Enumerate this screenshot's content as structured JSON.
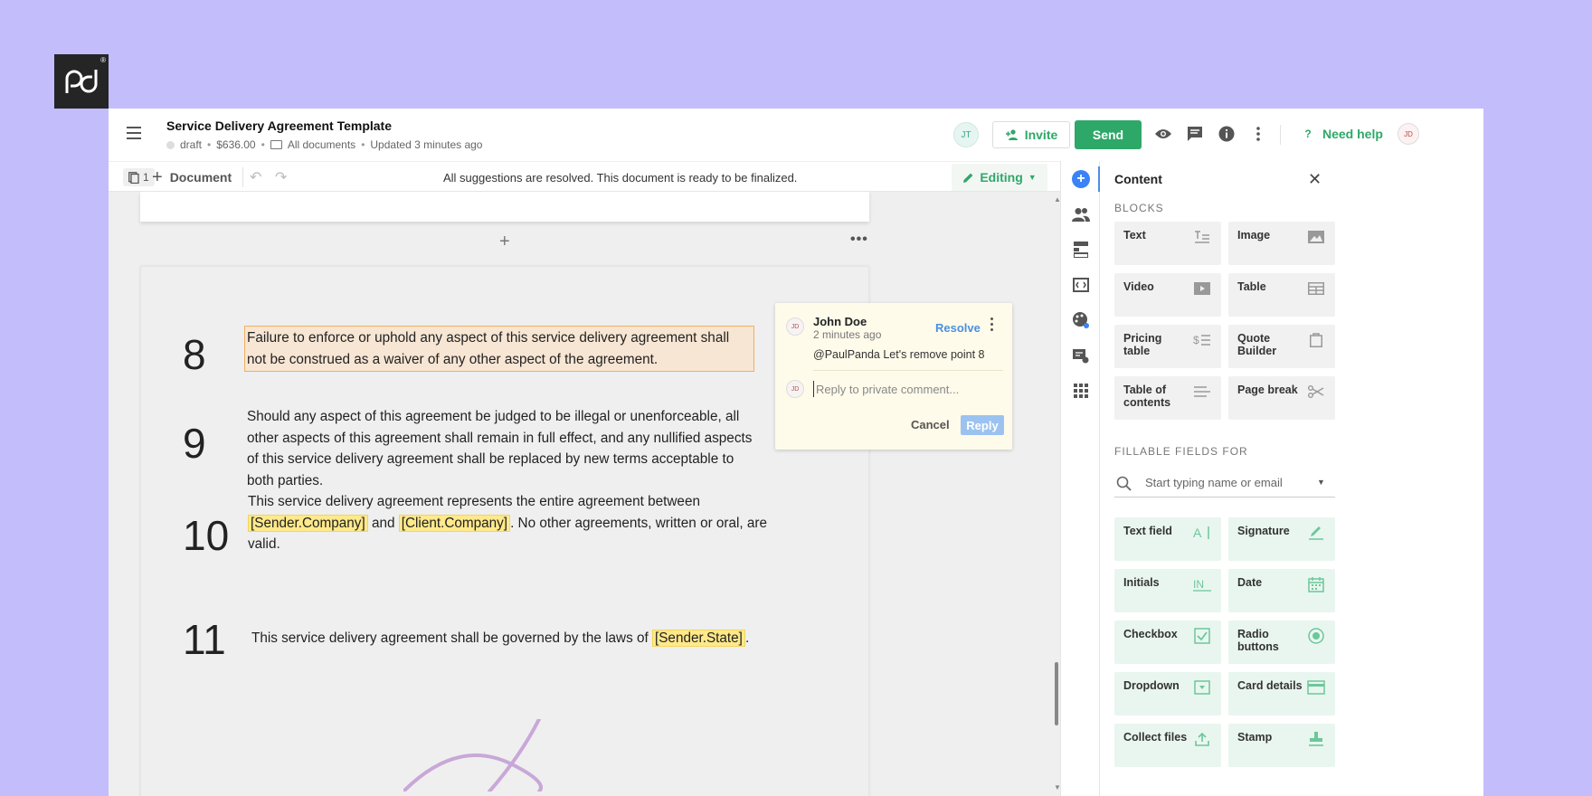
{
  "logo": {
    "reg": "®"
  },
  "header": {
    "title": "Service Delivery Agreement Template",
    "status": "draft",
    "price": "$636.00",
    "folder": "All documents",
    "updated": "Updated 3 minutes ago",
    "avatar_jt": "JT",
    "invite_label": "Invite",
    "send_label": "Send",
    "need_help_label": "Need help",
    "avatar_jd": "JD"
  },
  "toolbar": {
    "pages_count": "1",
    "add_document_label": "Document",
    "message": "All suggestions are resolved. This document is ready to be finalized.",
    "mode_label": "Editing"
  },
  "document": {
    "items": [
      {
        "num": "8",
        "text": "Failure to enforce or uphold any aspect of this service delivery agreement shall not be construed as a waiver of any other aspect of the agreement."
      },
      {
        "num": "9",
        "text": "Should any aspect of this agreement be judged to be illegal or unenforceable, all other aspects of this agreement shall remain in full effect, and any nullified aspects of this service delivery agreement shall be replaced by new terms acceptable to both parties."
      },
      {
        "num": "10",
        "text_a": "This service delivery agreement represents the entire agreement between",
        "var1": "[Sender.Company]",
        "text_b": "and",
        "var2": "[Client.Company]",
        "text_c": ". No other agreements, written or oral, are valid."
      },
      {
        "num": "11",
        "text_a": "This service delivery agreement shall be governed by the laws of",
        "var1": "[Sender.State]",
        "text_b": "."
      }
    ]
  },
  "comment": {
    "avatar": "JD",
    "author": "John Doe",
    "time": "2 minutes ago",
    "resolve_label": "Resolve",
    "body": "@PaulPanda Let's remove point 8",
    "reply_avatar": "JD",
    "reply_placeholder": "Reply to private comment...",
    "cancel_label": "Cancel",
    "reply_label": "Reply"
  },
  "panel": {
    "title": "Content",
    "blocks_label": "BLOCKS",
    "blocks": [
      {
        "label": "Text",
        "icon": "text-block-icon"
      },
      {
        "label": "Image",
        "icon": "image-icon"
      },
      {
        "label": "Video",
        "icon": "video-icon"
      },
      {
        "label": "Table",
        "icon": "table-icon"
      },
      {
        "label": "Pricing table",
        "icon": "pricing-table-icon"
      },
      {
        "label": "Quote Builder",
        "icon": "quote-builder-icon"
      },
      {
        "label": "Table of contents",
        "icon": "toc-icon"
      },
      {
        "label": "Page break",
        "icon": "scissors-icon"
      }
    ],
    "fields_label": "FILLABLE FIELDS FOR",
    "search_placeholder": "Start typing name or email",
    "fields": [
      {
        "label": "Text field",
        "icon": "text-field-icon"
      },
      {
        "label": "Signature",
        "icon": "signature-icon"
      },
      {
        "label": "Initials",
        "icon": "initials-icon"
      },
      {
        "label": "Date",
        "icon": "calendar-icon"
      },
      {
        "label": "Checkbox",
        "icon": "checkbox-icon"
      },
      {
        "label": "Radio buttons",
        "icon": "radio-icon"
      },
      {
        "label": "Dropdown",
        "icon": "dropdown-icon"
      },
      {
        "label": "Card details",
        "icon": "card-icon"
      },
      {
        "label": "Collect files",
        "icon": "upload-icon"
      },
      {
        "label": "Stamp",
        "icon": "stamp-icon"
      }
    ]
  },
  "colors": {
    "brand_green": "#2ea868",
    "accent_blue": "#4a90e2",
    "background": "#c4bdfc",
    "highlight_var": "#ffe98a"
  }
}
